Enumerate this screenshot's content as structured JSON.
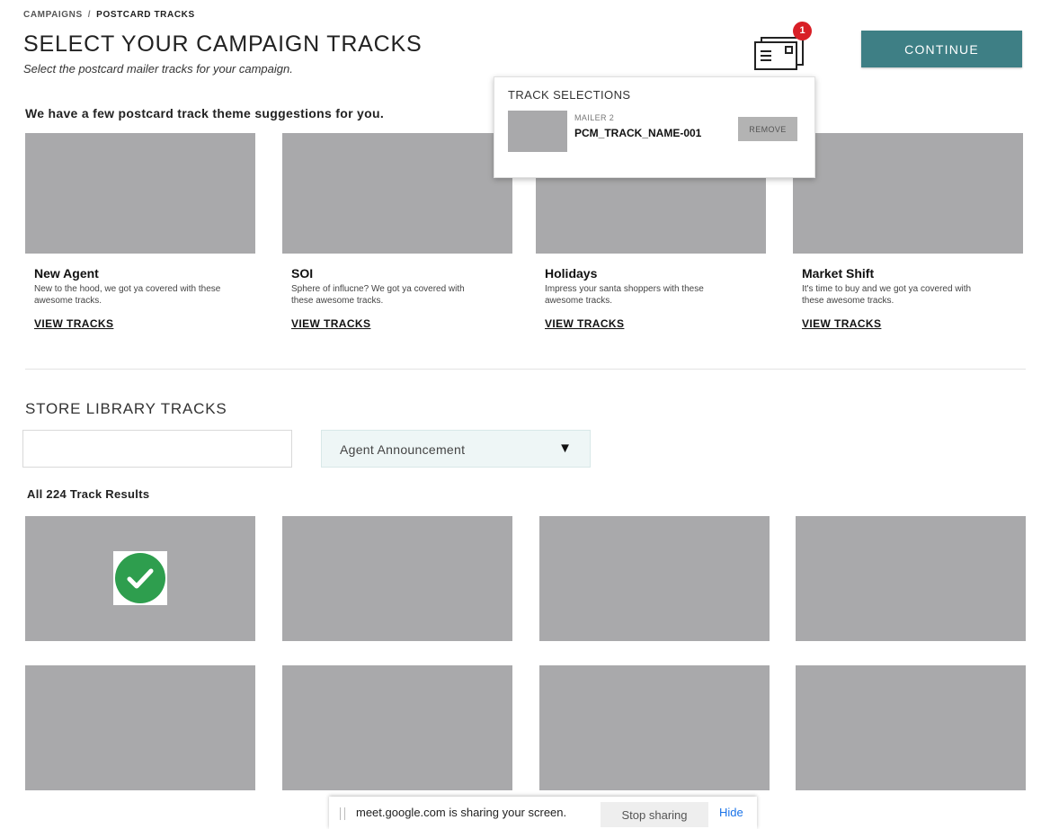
{
  "breadcrumb": {
    "parent": "CAMPAIGNS",
    "separator": "/",
    "current": "POSTCARD TRACKS"
  },
  "header": {
    "title": "SELECT YOUR CAMPAIGN TRACKS",
    "subtitle": "Select the postcard mailer tracks for your campaign.",
    "mailer_icon": "postcard-mailer-icon",
    "badge_count": "1",
    "continue_label": "CONTINUE",
    "accent_color": "#3e7f85",
    "badge_color": "#d81f26"
  },
  "track_selections": {
    "title": "TRACK SELECTIONS",
    "items": [
      {
        "mailer": "MAILER 2",
        "name": "PCM_TRACK_NAME-001",
        "remove_label": "REMOVE"
      }
    ]
  },
  "suggestions": {
    "heading": "We have a few postcard track theme suggestions for you.",
    "themes": [
      {
        "title": "New Agent",
        "description": "New to the hood, we got ya covered with these awesome tracks.",
        "link": "VIEW TRACKS"
      },
      {
        "title": "SOI",
        "description": "Sphere of influcne? We got ya covered with these awesome tracks.",
        "link": "VIEW TRACKS"
      },
      {
        "title": "Holidays",
        "description": "Impress your santa shoppers  with these awesome tracks.",
        "link": "VIEW TRACKS"
      },
      {
        "title": "Market Shift",
        "description": "It's time to buy and we got ya covered with these awesome tracks.",
        "link": "VIEW TRACKS"
      }
    ]
  },
  "library": {
    "heading": "STORE LIBRARY TRACKS",
    "search_value": "",
    "filter_value": "Agent Announcement",
    "filter_caret": "▼",
    "results_label": "All 224 Track Results",
    "tiles": [
      {
        "selected": true
      },
      {
        "selected": false
      },
      {
        "selected": false
      },
      {
        "selected": false
      },
      {
        "selected": false
      },
      {
        "selected": false
      },
      {
        "selected": false
      },
      {
        "selected": false
      }
    ],
    "selected_color": "#2e9e4e"
  },
  "screen_share": {
    "message": "meet.google.com is sharing your screen.",
    "stop_label": "Stop sharing",
    "hide_label": "Hide"
  }
}
